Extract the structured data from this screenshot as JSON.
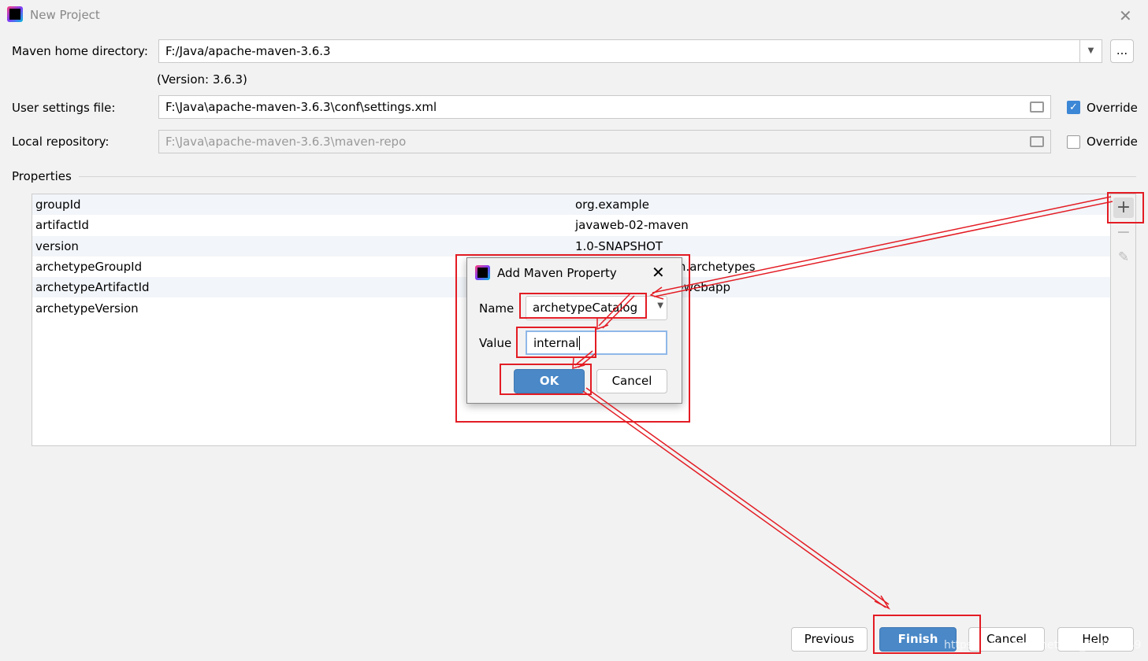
{
  "window": {
    "title": "New Project"
  },
  "form": {
    "maven_home_label": "Maven home directory:",
    "maven_home_value": "F:/Java/apache-maven-3.6.3",
    "browse_label": "...",
    "version_text": "(Version: 3.6.3)",
    "user_settings_label": "User settings file:",
    "user_settings_value": "F:\\Java\\apache-maven-3.6.3\\conf\\settings.xml",
    "user_settings_override": {
      "label": "Override",
      "checked": true
    },
    "local_repo_label": "Local repository:",
    "local_repo_value": "F:\\Java\\apache-maven-3.6.3\\maven-repo",
    "local_repo_override": {
      "label": "Override",
      "checked": false
    }
  },
  "properties": {
    "title": "Properties",
    "rows": [
      {
        "name": "groupId",
        "value": "org.example"
      },
      {
        "name": "artifactId",
        "value": "javaweb-02-maven"
      },
      {
        "name": "version",
        "value": "1.0-SNAPSHOT"
      },
      {
        "name": "archetypeGroupId",
        "value": "org.apache.maven.archetypes"
      },
      {
        "name": "archetypeArtifactId",
        "value": "maven-archetype-webapp"
      },
      {
        "name": "archetypeVersion",
        "value": ""
      }
    ]
  },
  "dialog": {
    "title": "Add Maven Property",
    "name_label": "Name",
    "name_value": "archetypeCatalog",
    "value_label": "Value",
    "value_value": "internal",
    "ok": "OK",
    "cancel": "Cancel"
  },
  "footer": {
    "previous": "Previous",
    "finish": "Finish",
    "cancel": "Cancel",
    "help": "Help"
  },
  "watermark": "https://blog.csdn.net/m0_46153949",
  "colors": {
    "accent": "#4a88c7",
    "annotation": "#e31c24"
  }
}
